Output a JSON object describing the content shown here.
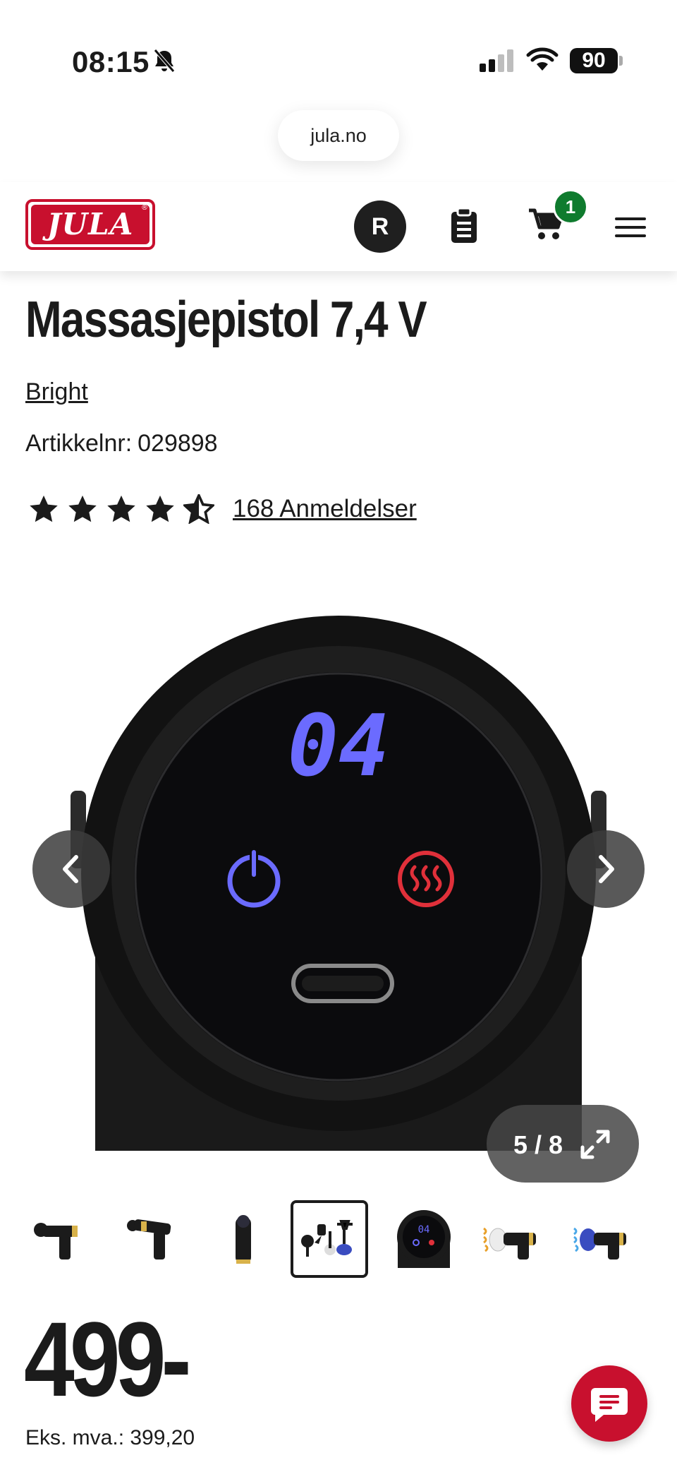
{
  "status_bar": {
    "time": "08:15",
    "battery": "90"
  },
  "browser": {
    "url": "jula.no"
  },
  "header": {
    "logo_text": "JULA",
    "avatar_initial": "R",
    "cart_count": "1"
  },
  "product": {
    "title": "Massasjepistol 7,4 V",
    "brand": "Bright",
    "article_label": "Artikkelnr:",
    "article_number": "029898",
    "rating": 4.5,
    "rating_max": 5,
    "reviews_label": "168 Anmeldelser",
    "display_digits": "04"
  },
  "gallery": {
    "counter": "5 / 8",
    "thumbnails": [
      "massage-gun-side",
      "massage-gun-angle",
      "massage-gun-upright",
      "attachments-set",
      "control-panel-closeup",
      "heat-head-warm",
      "heat-head-cool"
    ],
    "active_thumbnail_index": 3
  },
  "pricing": {
    "price": "499-",
    "vat_label": "Eks. mva.: 399,20"
  },
  "colors": {
    "brand_red": "#c8102e",
    "badge_green": "#0f7b2e",
    "dark": "#1b1b1b"
  }
}
